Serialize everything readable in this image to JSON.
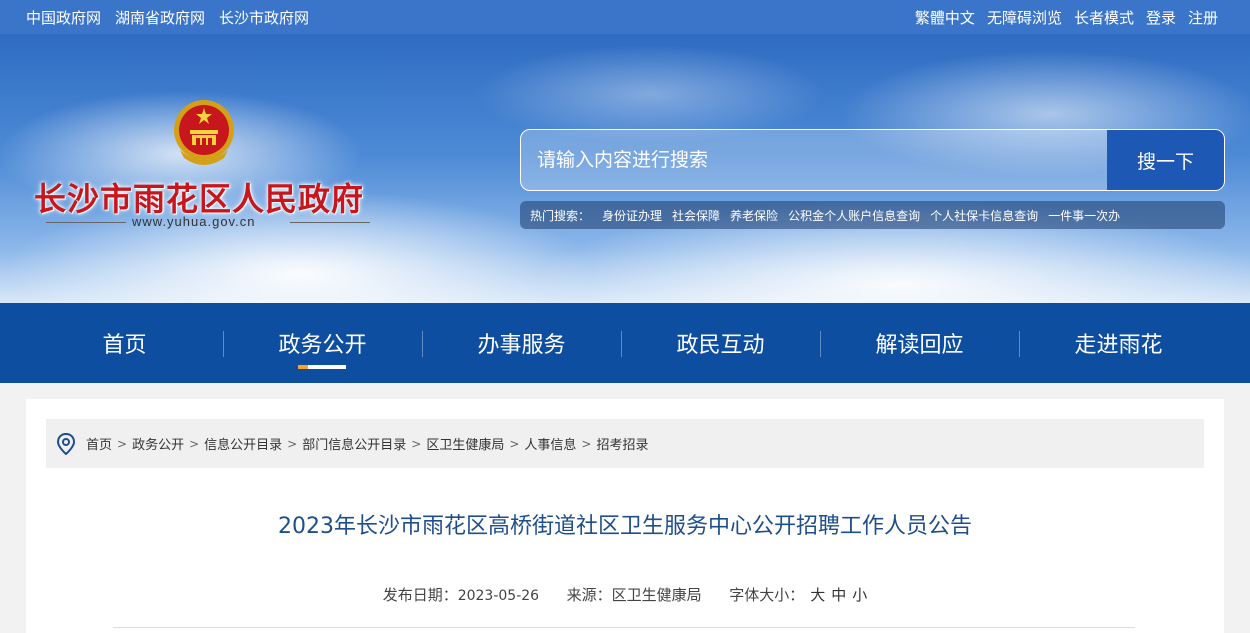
{
  "topbar": {
    "left_links": [
      "中国政府网",
      "湖南省政府网",
      "长沙市政府网"
    ],
    "right_links": [
      "繁體中文",
      "无障碍浏览",
      "长者模式",
      "登录",
      "注册"
    ]
  },
  "header": {
    "site_name": "长沙市雨花区人民政府",
    "site_url": "www.yuhua.gov.cn"
  },
  "search": {
    "placeholder": "请输入内容进行搜索",
    "button_label": "搜一下"
  },
  "hot_search": {
    "label": "热门搜索：",
    "items": [
      "身份证办理",
      "社会保障",
      "养老保险",
      "公积金个人账户信息查询",
      "个人社保卡信息查询",
      "一件事一次办"
    ]
  },
  "nav": {
    "items": [
      "首页",
      "政务公开",
      "办事服务",
      "政民互动",
      "解读回应",
      "走进雨花"
    ],
    "active": "政务公开"
  },
  "breadcrumb": [
    "首页",
    "政务公开",
    "信息公开目录",
    "部门信息公开目录",
    "区卫生健康局",
    "人事信息",
    "招考招录"
  ],
  "article": {
    "title": "2023年长沙市雨花区高桥街道社区卫生服务中心公开招聘工作人员公告",
    "date_label": "发布日期：",
    "date": "2023-05-26",
    "source_label": "来源：",
    "source": "区卫生健康局",
    "font_size_label": "字体大小：",
    "font_sizes": [
      "大",
      "中",
      "小"
    ]
  },
  "colors": {
    "topbar": "#3b75c9",
    "nav": "#0e4ea1",
    "site_name": "#c8161d",
    "title": "#1f4e8c",
    "search_button": "#1d58b4"
  }
}
